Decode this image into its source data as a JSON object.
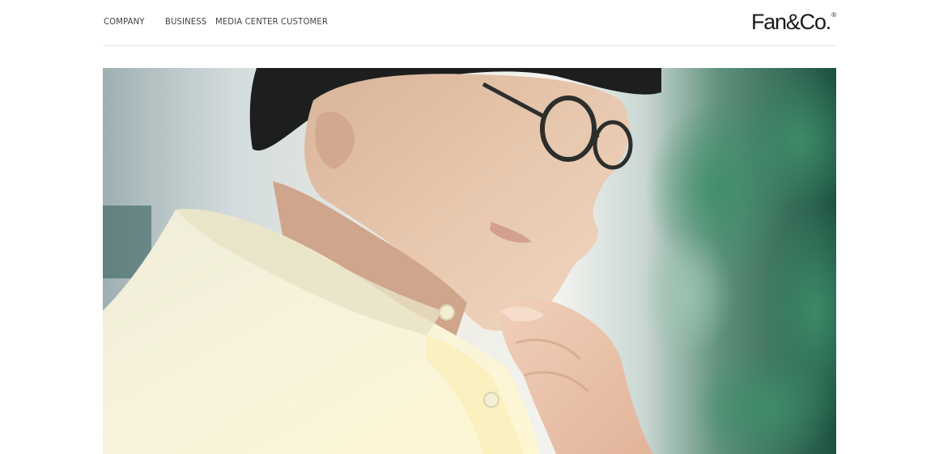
{
  "nav": {
    "items": [
      {
        "label": "COMPANY"
      },
      {
        "label": "BUSINESS"
      },
      {
        "label": "MEDIA CENTER"
      },
      {
        "label": "CUSTOMER"
      }
    ]
  },
  "logo": {
    "text": "Fan&Co.",
    "reg": "®"
  },
  "hero": {
    "icon": "hero-photo"
  },
  "colors": {
    "nav_text": "#444444",
    "logo": "#1a1a1a",
    "divider": "#e8e8e8",
    "background": "#ffffff"
  }
}
